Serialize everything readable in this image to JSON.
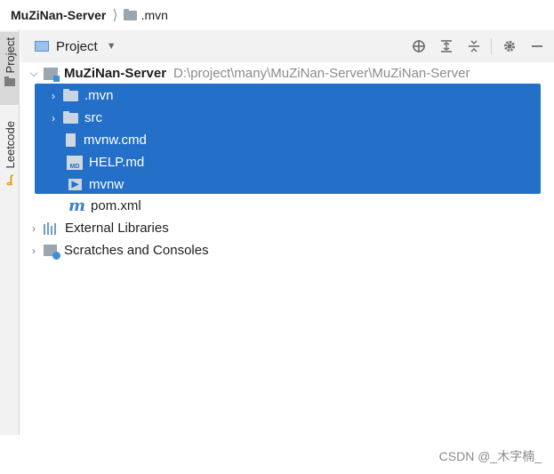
{
  "breadcrumb": {
    "root": "MuZiNan-Server",
    "folder": ".mvn"
  },
  "side_tabs": {
    "project": "Project",
    "leetcode": "Leetcode"
  },
  "panel": {
    "view_selector": "Project"
  },
  "tree": {
    "root": {
      "name": "MuZiNan-Server",
      "path": "D:\\project\\many\\MuZiNan-Server\\MuZiNan-Server"
    },
    "items": [
      {
        "label": ".mvn"
      },
      {
        "label": "src"
      },
      {
        "label": "mvnw.cmd"
      },
      {
        "label": "HELP.md"
      },
      {
        "label": "mvnw"
      },
      {
        "label": "pom.xml"
      }
    ],
    "external_libraries": "External Libraries",
    "scratches": "Scratches and Consoles"
  },
  "icons": {
    "maven_letter": "m",
    "markdown_badge": "MD",
    "exec_badge": "▶"
  },
  "watermark": "CSDN @_木字楠_",
  "colors": {
    "selection": "#2470c8",
    "panel_bg": "#f2f2f2"
  }
}
